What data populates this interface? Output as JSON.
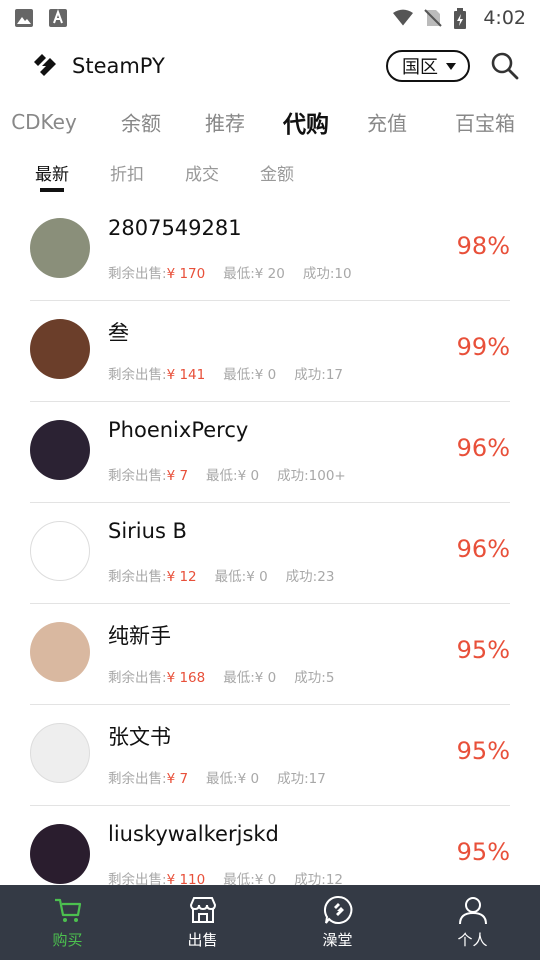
{
  "status_bar": {
    "time": "4:02"
  },
  "header": {
    "title": "SteamPY",
    "region": "国区"
  },
  "category_tabs": [
    "CDKey",
    "余额",
    "推荐",
    "代购",
    "充值",
    "百宝箱"
  ],
  "active_category": "代购",
  "sub_tabs": [
    "最新",
    "折扣",
    "成交",
    "金额"
  ],
  "active_sub_tab": "最新",
  "meta_labels": {
    "remaining": "剩余出售:",
    "min": "最低:",
    "success": "成功:"
  },
  "sellers": [
    {
      "name": "2807549281",
      "remaining": "¥ 170",
      "min": "¥ 20",
      "success": "10",
      "rate": "98%",
      "avatar_color": "#8a8f7a"
    },
    {
      "name": "叁",
      "remaining": "¥ 141",
      "min": "¥ 0",
      "success": "17",
      "rate": "99%",
      "avatar_color": "#6b3e2a"
    },
    {
      "name": "PhoenixPercy",
      "remaining": "¥ 7",
      "min": "¥ 0",
      "success": "100+",
      "rate": "96%",
      "avatar_color": "#2b2233"
    },
    {
      "name": "Sirius B",
      "remaining": "¥ 12",
      "min": "¥ 0",
      "success": "23",
      "rate": "96%",
      "avatar_color": "#ffffff"
    },
    {
      "name": "纯新手",
      "remaining": "¥ 168",
      "min": "¥ 0",
      "success": "5",
      "rate": "95%",
      "avatar_color": "#d9b8a0"
    },
    {
      "name": "张文书",
      "remaining": "¥ 7",
      "min": "¥ 0",
      "success": "17",
      "rate": "95%",
      "avatar_color": "#eeeeee"
    },
    {
      "name": "liuskywalkerjskd",
      "remaining": "¥ 110",
      "min": "¥ 0",
      "success": "12",
      "rate": "95%",
      "avatar_color": "#2a1d2e"
    }
  ],
  "bottom_nav": [
    {
      "label": "购买",
      "icon": "cart-icon",
      "active": true
    },
    {
      "label": "出售",
      "icon": "store-icon",
      "active": false
    },
    {
      "label": "澡堂",
      "icon": "steam-chat-icon",
      "active": false
    },
    {
      "label": "个人",
      "icon": "user-icon",
      "active": false
    }
  ],
  "colors": {
    "accent_red": "#e8503a",
    "nav_bg": "#343a45",
    "nav_active": "#4cc04f"
  }
}
